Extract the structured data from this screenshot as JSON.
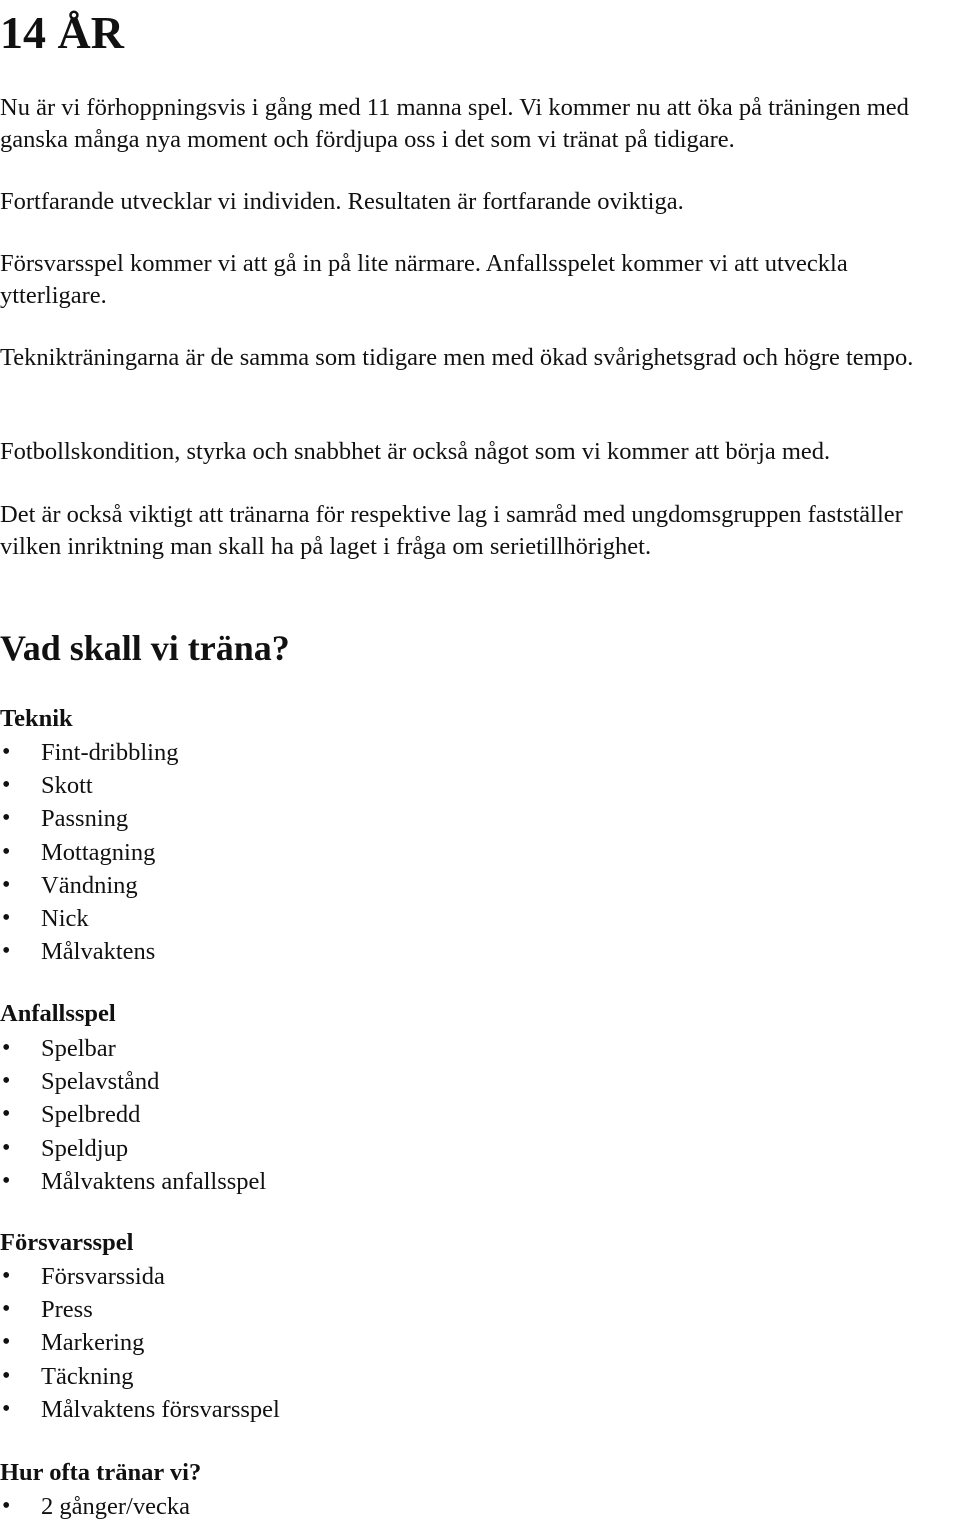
{
  "title": "14 ÅR",
  "paragraphs": [
    "Nu är vi förhoppningsvis i gång med 11 manna spel. Vi kommer nu att öka på träningen med ganska många nya moment och fördjupa oss i det som vi tränat på tidigare.",
    "Fortfarande utvecklar vi individen. Resultaten är fortfarande oviktiga.",
    "Försvarsspel kommer vi att gå in på lite närmare. Anfallsspelet kommer vi att utveckla ytterligare.",
    "Teknikträningarna är de samma som tidigare men med ökad svårighetsgrad och högre tempo.",
    "Fotbollskondition, styrka och snabbhet är också något som vi kommer att börja med.",
    "Det är också viktigt att tränarna för respektive lag i samråd med ungdomsgruppen fastställer vilken inriktning man skall ha på laget i fråga om serietillhörighet."
  ],
  "section_heading": "Vad skall vi träna?",
  "bullet_glyph": "•",
  "sections": [
    {
      "heading": "Teknik",
      "items": [
        "Fint-dribbling",
        "Skott",
        "Passning",
        "Mottagning",
        "Vändning",
        "Nick",
        "Målvaktens"
      ]
    },
    {
      "heading": "Anfallsspel",
      "items": [
        "Spelbar",
        "Spelavstånd",
        "Spelbredd",
        "Speldjup",
        "Målvaktens anfallsspel"
      ]
    },
    {
      "heading": "Försvarsspel",
      "items": [
        "Försvarssida",
        "Press",
        "Markering",
        "Täckning",
        "Målvaktens försvarsspel"
      ]
    },
    {
      "heading": "Hur ofta tränar vi?",
      "items": [
        "2 gånger/vecka"
      ]
    }
  ]
}
